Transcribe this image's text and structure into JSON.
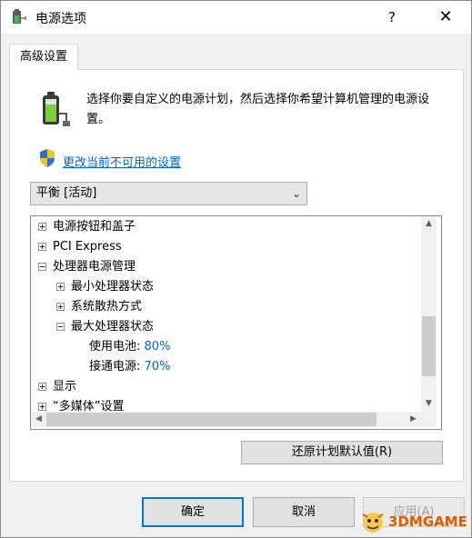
{
  "window": {
    "title": "电源选项",
    "help": "?",
    "close": "✕"
  },
  "tab": {
    "label": "高级设置"
  },
  "description": "选择你要自定义的电源计划，然后选择你希望计算机管理的电源设置。",
  "change_link": "更改当前不可用的设置",
  "plan_select": {
    "value": "平衡 [活动]"
  },
  "tree": {
    "items": [
      {
        "label": "电源按钮和盖子",
        "expander": "plus"
      },
      {
        "label": "PCI Express",
        "expander": "plus"
      },
      {
        "label": "处理器电源管理",
        "expander": "minus"
      },
      {
        "label": "最小处理器状态",
        "expander": "plus"
      },
      {
        "label": "系统散热方式",
        "expander": "plus"
      },
      {
        "label": "最大处理器状态",
        "expander": "minus"
      },
      {
        "label": "使用电池:",
        "value": "80%"
      },
      {
        "label": "接通电源:",
        "value": "70%"
      },
      {
        "label": "显示",
        "expander": "plus"
      },
      {
        "label": "“多媒体”设置",
        "expander": "plus"
      }
    ]
  },
  "restore_button": "还原计划默认值(R)",
  "buttons": {
    "ok": "确定",
    "cancel": "取消",
    "apply": "应用(A)"
  },
  "watermark": "3DMGAME",
  "colors": {
    "link": "#0066cc",
    "value": "#0066cc",
    "focus_border": "#0078d7"
  }
}
